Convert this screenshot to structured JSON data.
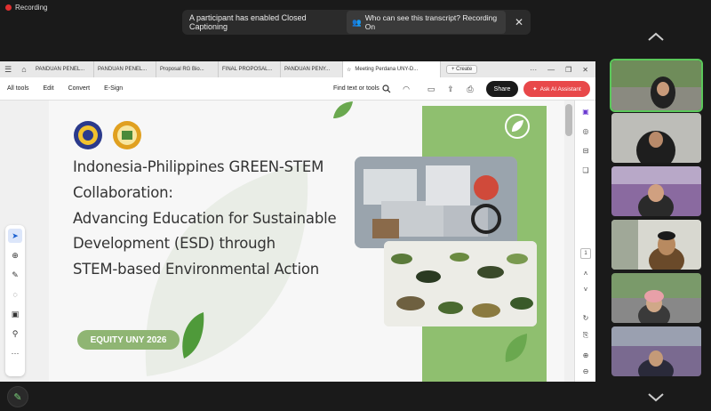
{
  "meeting": {
    "recording_label": "Recording",
    "cc_notice": "A participant has enabled Closed Captioning",
    "transcript_pill": "Who can see this transcript? Recording On"
  },
  "tabs": [
    {
      "label": "PANDUAN PENEL..."
    },
    {
      "label": "PANDUAN PENEL..."
    },
    {
      "label": "Proposal RG Bio..."
    },
    {
      "label": "FINAL PROPOSAL..."
    },
    {
      "label": "PANDUAN PENY..."
    },
    {
      "label": "Meeting Perdana UNY-D..."
    }
  ],
  "tab_create": "+ Create",
  "menu": {
    "all_tools": "All tools",
    "edit": "Edit",
    "convert": "Convert",
    "esign": "E-Sign",
    "find": "Find text or tools",
    "share": "Share",
    "ai": "Ask AI Assistant"
  },
  "slide": {
    "title_lines": [
      "Indonesia-Philippines GREEN-STEM",
      "Collaboration:",
      "Advancing Education for Sustainable",
      "Development (ESD) through",
      "STEM-based Environmental Action"
    ],
    "badge": "EQUITY UNY 2026"
  },
  "page_indicator": "1",
  "colors": {
    "accent_green": "#8fbf6f",
    "ai_red": "#e8484a",
    "active_tile": "#5ac85a"
  }
}
